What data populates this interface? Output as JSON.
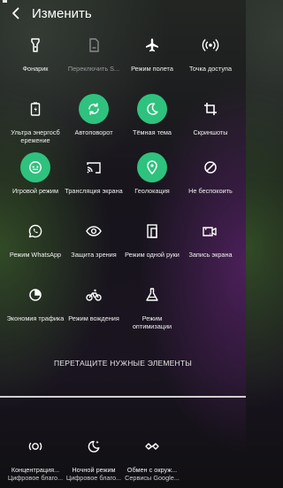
{
  "header": {
    "title": "Изменить",
    "back_icon": "chevron-left-icon"
  },
  "accent_color": "#2ec27e",
  "tiles": [
    {
      "label": "Фонарик",
      "icon": "flashlight-icon",
      "active": false
    },
    {
      "label": "Переключить S...",
      "icon": "sim-card-icon",
      "active": false,
      "disabled": true
    },
    {
      "label": "Режим полета",
      "icon": "airplane-icon",
      "active": false
    },
    {
      "label": "Точка доступа",
      "icon": "hotspot-icon",
      "active": false
    },
    {
      "label": "Ультра энергосб ережение",
      "icon": "battery-saver-icon",
      "active": false
    },
    {
      "label": "Автоповорот",
      "icon": "auto-rotate-icon",
      "active": true
    },
    {
      "label": "Тёмная тема",
      "icon": "moon-icon",
      "active": true
    },
    {
      "label": "Скриншоты",
      "icon": "crop-icon",
      "active": false
    },
    {
      "label": "Игровой режим",
      "icon": "gamepad-icon",
      "active": true
    },
    {
      "label": "Трансляция экрана",
      "icon": "cast-icon",
      "active": false
    },
    {
      "label": "Геолокация",
      "icon": "location-icon",
      "active": true
    },
    {
      "label": "Не беспокоить",
      "icon": "do-not-disturb-icon",
      "active": false
    },
    {
      "label": "Режим WhatsApp",
      "icon": "whatsapp-icon",
      "active": false
    },
    {
      "label": "Защита зрения",
      "icon": "eye-icon",
      "active": false
    },
    {
      "label": "Режим одной руки",
      "icon": "one-hand-icon",
      "active": false
    },
    {
      "label": "Запись экрана",
      "icon": "screen-record-icon",
      "active": false
    },
    {
      "label": "Экономия трафика",
      "icon": "data-saver-icon",
      "active": false
    },
    {
      "label": "Режим вождения",
      "icon": "bike-icon",
      "active": false
    },
    {
      "label": "Режим оптимизации",
      "icon": "flask-icon",
      "active": false
    }
  ],
  "drag_hint": "ПЕРЕТАЩИТЕ НУЖНЫЕ ЭЛЕМЕНТЫ",
  "available_tiles": [
    {
      "label": "Концентрация...",
      "source": "Цифровое благо...",
      "icon": "focus-icon"
    },
    {
      "label": "Ночной режим",
      "source": "Цифровое благо...",
      "icon": "bedtime-icon"
    },
    {
      "label": "Обмен с окруж...",
      "source": "Сервисы Google...",
      "icon": "nearby-share-icon"
    }
  ]
}
